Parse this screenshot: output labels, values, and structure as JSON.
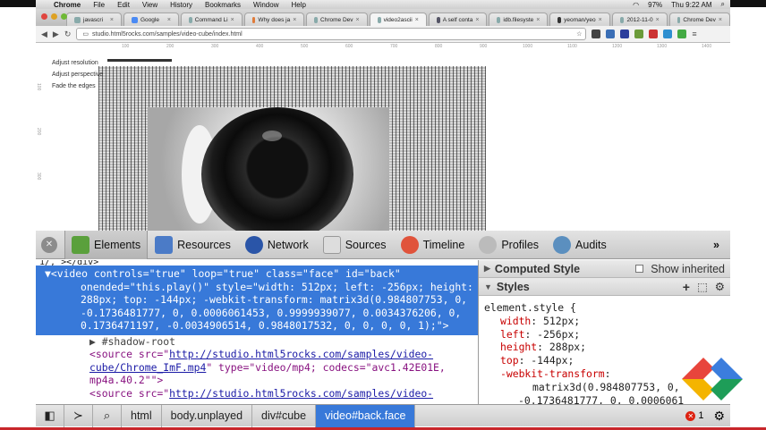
{
  "menubar": {
    "app": "Chrome",
    "items": [
      "File",
      "Edit",
      "View",
      "History",
      "Bookmarks",
      "Window",
      "Help"
    ],
    "battery": "97%",
    "clock": "Thu 9:22 AM"
  },
  "tabs": [
    {
      "label": "javascri"
    },
    {
      "label": "Google"
    },
    {
      "label": "Command Li"
    },
    {
      "label": "Why does ja"
    },
    {
      "label": "Chrome Dev"
    },
    {
      "label": "video2ascii"
    },
    {
      "label": "A self conta"
    },
    {
      "label": "idb.filesyste"
    },
    {
      "label": "yeoman/yeo"
    },
    {
      "label": "2012-11-0"
    },
    {
      "label": "Chrome Dev"
    }
  ],
  "active_tab_index": 5,
  "toolbar": {
    "url": "studio.html5rocks.com/samples/video-cube/index.html"
  },
  "page": {
    "controls": [
      "Adjust resolution",
      "Adjust perspective",
      "Fade the edges"
    ],
    "ruler_top": [
      "100",
      "200",
      "300",
      "400",
      "500",
      "600",
      "700",
      "800",
      "900",
      "1000",
      "1100",
      "1200",
      "1300",
      "1400"
    ],
    "ruler_left": [
      "100",
      "200",
      "300"
    ]
  },
  "devtools": {
    "tabs": [
      {
        "label": "Elements",
        "color": "#5aa03c"
      },
      {
        "label": "Resources",
        "color": "#4b7bc7"
      },
      {
        "label": "Network",
        "color": "#2a55a8"
      },
      {
        "label": "Sources",
        "color": "#c44"
      },
      {
        "label": "Timeline",
        "color": "#e0533b"
      },
      {
        "label": "Profiles",
        "color": "#888"
      },
      {
        "label": "Audits",
        "color": "#5b8fbf"
      }
    ],
    "more": "»",
    "code": {
      "cut_line": "1/, ></div>",
      "selected_line": "▼<video controls=\"true\" loop=\"true\" class=\"face\" id=\"back\" onended=\"this.play()\" style=\"width: 512px; left: -256px; height: 288px; top: -144px; -webkit-transform: matrix3d(0.984807753, 0, -0.1736481777, 0, 0.0006061453, 0.9999939077, 0.0034376206, 0, 0.1736471197, -0.0034906514, 0.9848017532, 0, 0, 0, 0, 1);\">",
      "shadow_root": "▶ #shadow-root",
      "source1_prefix": "<source src=\"",
      "source1_url": "http://studio.html5rocks.com/samples/video-cube/Chrome_ImF.mp4",
      "source1_suffix": "\" type=\"video/mp4; codecs=\"avc1.42E01E, mp4a.40.2\"\">",
      "source2_prefix": "<source src=\"",
      "source2_url": "http://studio.html5rocks.com/samples/video-"
    },
    "sidebar": {
      "computed_title": "Computed Style",
      "show_inherited": "Show inherited",
      "styles_title": "Styles",
      "selector": "element.style {",
      "props": [
        {
          "name": "width",
          "value": "512px;"
        },
        {
          "name": "left",
          "value": "-256px;"
        },
        {
          "name": "height",
          "value": "288px;"
        },
        {
          "name": "top",
          "value": "-144px;"
        },
        {
          "name": "-webkit-transform",
          "value": ""
        }
      ],
      "transform_lines": [
        "matrix3d(0.984807753, 0,",
        "-0.1736481777, 0, 0.0006061"
      ]
    },
    "breadcrumbs": [
      "html",
      "body.unplayed",
      "div#cube",
      "video#back.face"
    ],
    "active_crumb_index": 3,
    "error_count": "1"
  }
}
